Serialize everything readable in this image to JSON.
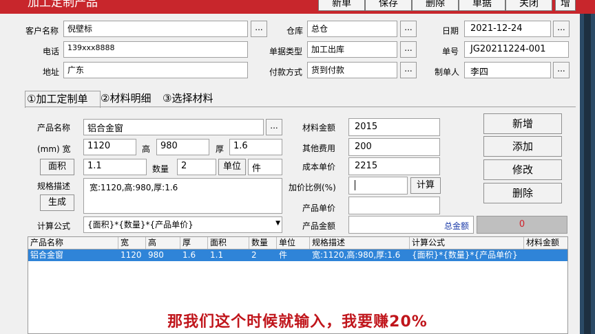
{
  "window": {
    "title": "加工定制产品"
  },
  "toolbar": {
    "new": "新单",
    "save": "保存",
    "delete": "删除",
    "document": "单据",
    "close": "关闭",
    "extra": "增"
  },
  "header": {
    "customer_label": "客户名称",
    "customer_value": "倪壁标",
    "warehouse_label": "仓库",
    "warehouse_value": "总仓",
    "date_label": "日期",
    "date_value": "2021-12-24",
    "phone_label": "电话",
    "phone_value": "139xxx8888",
    "doctype_label": "单据类型",
    "doctype_value": "加工出库",
    "docno_label": "单号",
    "docno_value": "JG20211224-001",
    "address_label": "地址",
    "address_value": "广东",
    "payment_label": "付款方式",
    "payment_value": "货到付款",
    "maker_label": "制单人",
    "maker_value": "李四",
    "dots": "..."
  },
  "tabs": [
    "①加工定制单",
    "②材料明细",
    "③选择材料"
  ],
  "form": {
    "product_label": "产品名称",
    "product_value": "铝合金窗",
    "mm_label": "(mm) 宽",
    "width_value": "1120",
    "height_label": "高",
    "height_value": "980",
    "thick_label": "厚",
    "thick_value": "1.6",
    "area_button": "面积",
    "area_value": "1.1",
    "qty_label": "数量",
    "qty_value": "2",
    "unit_button": "单位",
    "unit_value": "件",
    "spec_label": "规格描述",
    "spec_value": "宽:1120,高:980,厚:1.6",
    "generate_button": "生成",
    "formula_label": "计算公式",
    "formula_value": "{面积}*{数量}*{产品单价}",
    "material_amount_label": "材料金额",
    "material_amount_value": "2015",
    "other_fee_label": "其他费用",
    "other_fee_value": "200",
    "cost_price_label": "成本单价",
    "cost_price_value": "2215",
    "markup_label": "加价比例(%)",
    "markup_value": "",
    "calc_button": "计算",
    "unit_price_label": "产品单价",
    "unit_price_value": "",
    "product_amount_label": "产品金额",
    "product_amount_value": "",
    "total_label": "总金额",
    "total_value": "0"
  },
  "side_buttons": {
    "new": "新增",
    "add": "添加",
    "edit": "修改",
    "delete": "删除"
  },
  "table": {
    "columns": [
      "产品名称",
      "宽",
      "高",
      "厚",
      "面积",
      "数量",
      "单位",
      "规格描述",
      "计算公式",
      "材料金额"
    ],
    "rows": [
      [
        "铝合金窗",
        "1120",
        "980",
        "1.6",
        "1.1",
        "2",
        "件",
        "宽:1120,高:980,厚:1.6",
        "{面积}*{数量}*{产品单价}",
        ""
      ]
    ]
  },
  "caption": "那我们这个时候就输入，我要赚20%",
  "colors": {
    "titlebar": "#c8262c",
    "selected_row": "#2f84d8",
    "total_text": "#d0202a",
    "caption": "#c0151b"
  }
}
